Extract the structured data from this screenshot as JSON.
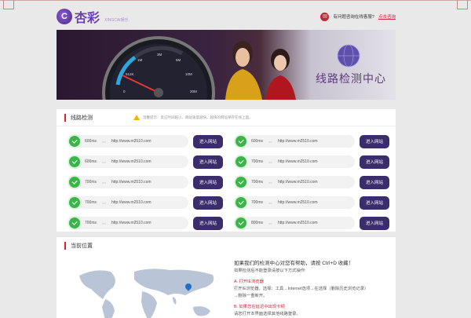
{
  "header": {
    "logo_text": "杏彩",
    "logo_sub": "XINGCAI娱乐",
    "help_text": "有问题咨询在线客服?",
    "help_link": "点击咨询"
  },
  "banner": {
    "title": "线路检测中心",
    "speed_labels": [
      "0",
      "512K",
      "1M",
      "3M",
      "5M",
      "10M",
      "20M"
    ]
  },
  "detect": {
    "title": "线路检测",
    "notice": "温馨提示：反应时间越小、网站速度越快。越快的网址保存在线上面。",
    "lines": [
      {
        "ms": "600ms",
        "url": "http://www.m2510.com",
        "button": "进入网站"
      },
      {
        "ms": "600ms",
        "url": "http://www.m2510.com",
        "button": "进入网站"
      },
      {
        "ms": "600ms",
        "url": "http://www.m2510.com",
        "button": "进入网站"
      },
      {
        "ms": "700ms",
        "url": "http://www.m2510.com",
        "button": "进入网站"
      },
      {
        "ms": "700ms",
        "url": "http://www.m2510.com",
        "button": "进入网站"
      },
      {
        "ms": "700ms",
        "url": "http://www.m2510.com",
        "button": "进入网站"
      },
      {
        "ms": "700ms",
        "url": "http://www.m2510.com",
        "button": "进入网站"
      },
      {
        "ms": "700ms",
        "url": "http://www.m2510.com",
        "button": "进入网站"
      },
      {
        "ms": "700ms",
        "url": "http://www.m2510.com",
        "button": "进入网站"
      },
      {
        "ms": "800ms",
        "url": "http://www.m2510.com",
        "button": "进入网站"
      }
    ],
    "separator": ">>"
  },
  "location": {
    "title": "当前位置",
    "info_lines": [
      "如果我们的检测中心对您有帮助，请按 Ctrl+D 收藏！",
      "如果检测后不能登录请按以下方式操作:",
      "A. 打开IE浏览器",
      "打开IE浏览器，选择：工具→Internet选项→在选择（删除历史浏览记录）",
      "→删除一重新开。",
      "B. 如果您在延迟中出现卡顿",
      "请您打开本界面选择其他线路登录。"
    ]
  },
  "colors": {
    "accent": "#3b2d6b",
    "status_ok": "#3bb54a",
    "red": "#d2233c"
  }
}
